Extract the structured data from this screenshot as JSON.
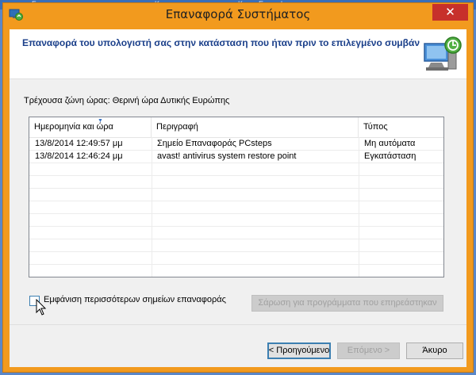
{
  "background_strip": {
    "fragments": [
      "Fm... ...yp... ...rp",
      "m... ...Krm... ...rp",
      "Kr... ...Ec... ...l... ...m"
    ]
  },
  "window": {
    "title": "Επαναφορά Συστήματος",
    "close_glyph": "✕",
    "accent_color": "#f29a1e"
  },
  "header": {
    "instruction": "Επαναφορά του υπολογιστή σας στην κατάσταση που ήταν πριν το επιλεγμένο συμβάν",
    "icon": "system-restore-icon"
  },
  "timezone_text": "Τρέχουσα ζώνη ώρας: Θερινή ώρα Δυτικής Ευρώπης",
  "restore_points": {
    "columns": [
      "Ημερομηνία και ώρα",
      "Περιγραφή",
      "Τύπος"
    ],
    "rows": [
      {
        "datetime": "13/8/2014 12:49:57 μμ",
        "description": "Σημείο Επαναφοράς PCsteps",
        "type": "Μη αυτόματα"
      },
      {
        "datetime": "13/8/2014 12:46:24 μμ",
        "description": "avast! antivirus system restore point",
        "type": "Εγκατάσταση"
      }
    ]
  },
  "show_more": {
    "label": "Εμφάνιση περισσότερων σημείων επαναφοράς",
    "checked": false
  },
  "buttons": {
    "scan": "Σάρωση για προγράμματα που επηρεάστηκαν",
    "back": "< Προηγούμενο",
    "next": "Επόμενο >",
    "cancel": "Άκυρο"
  }
}
